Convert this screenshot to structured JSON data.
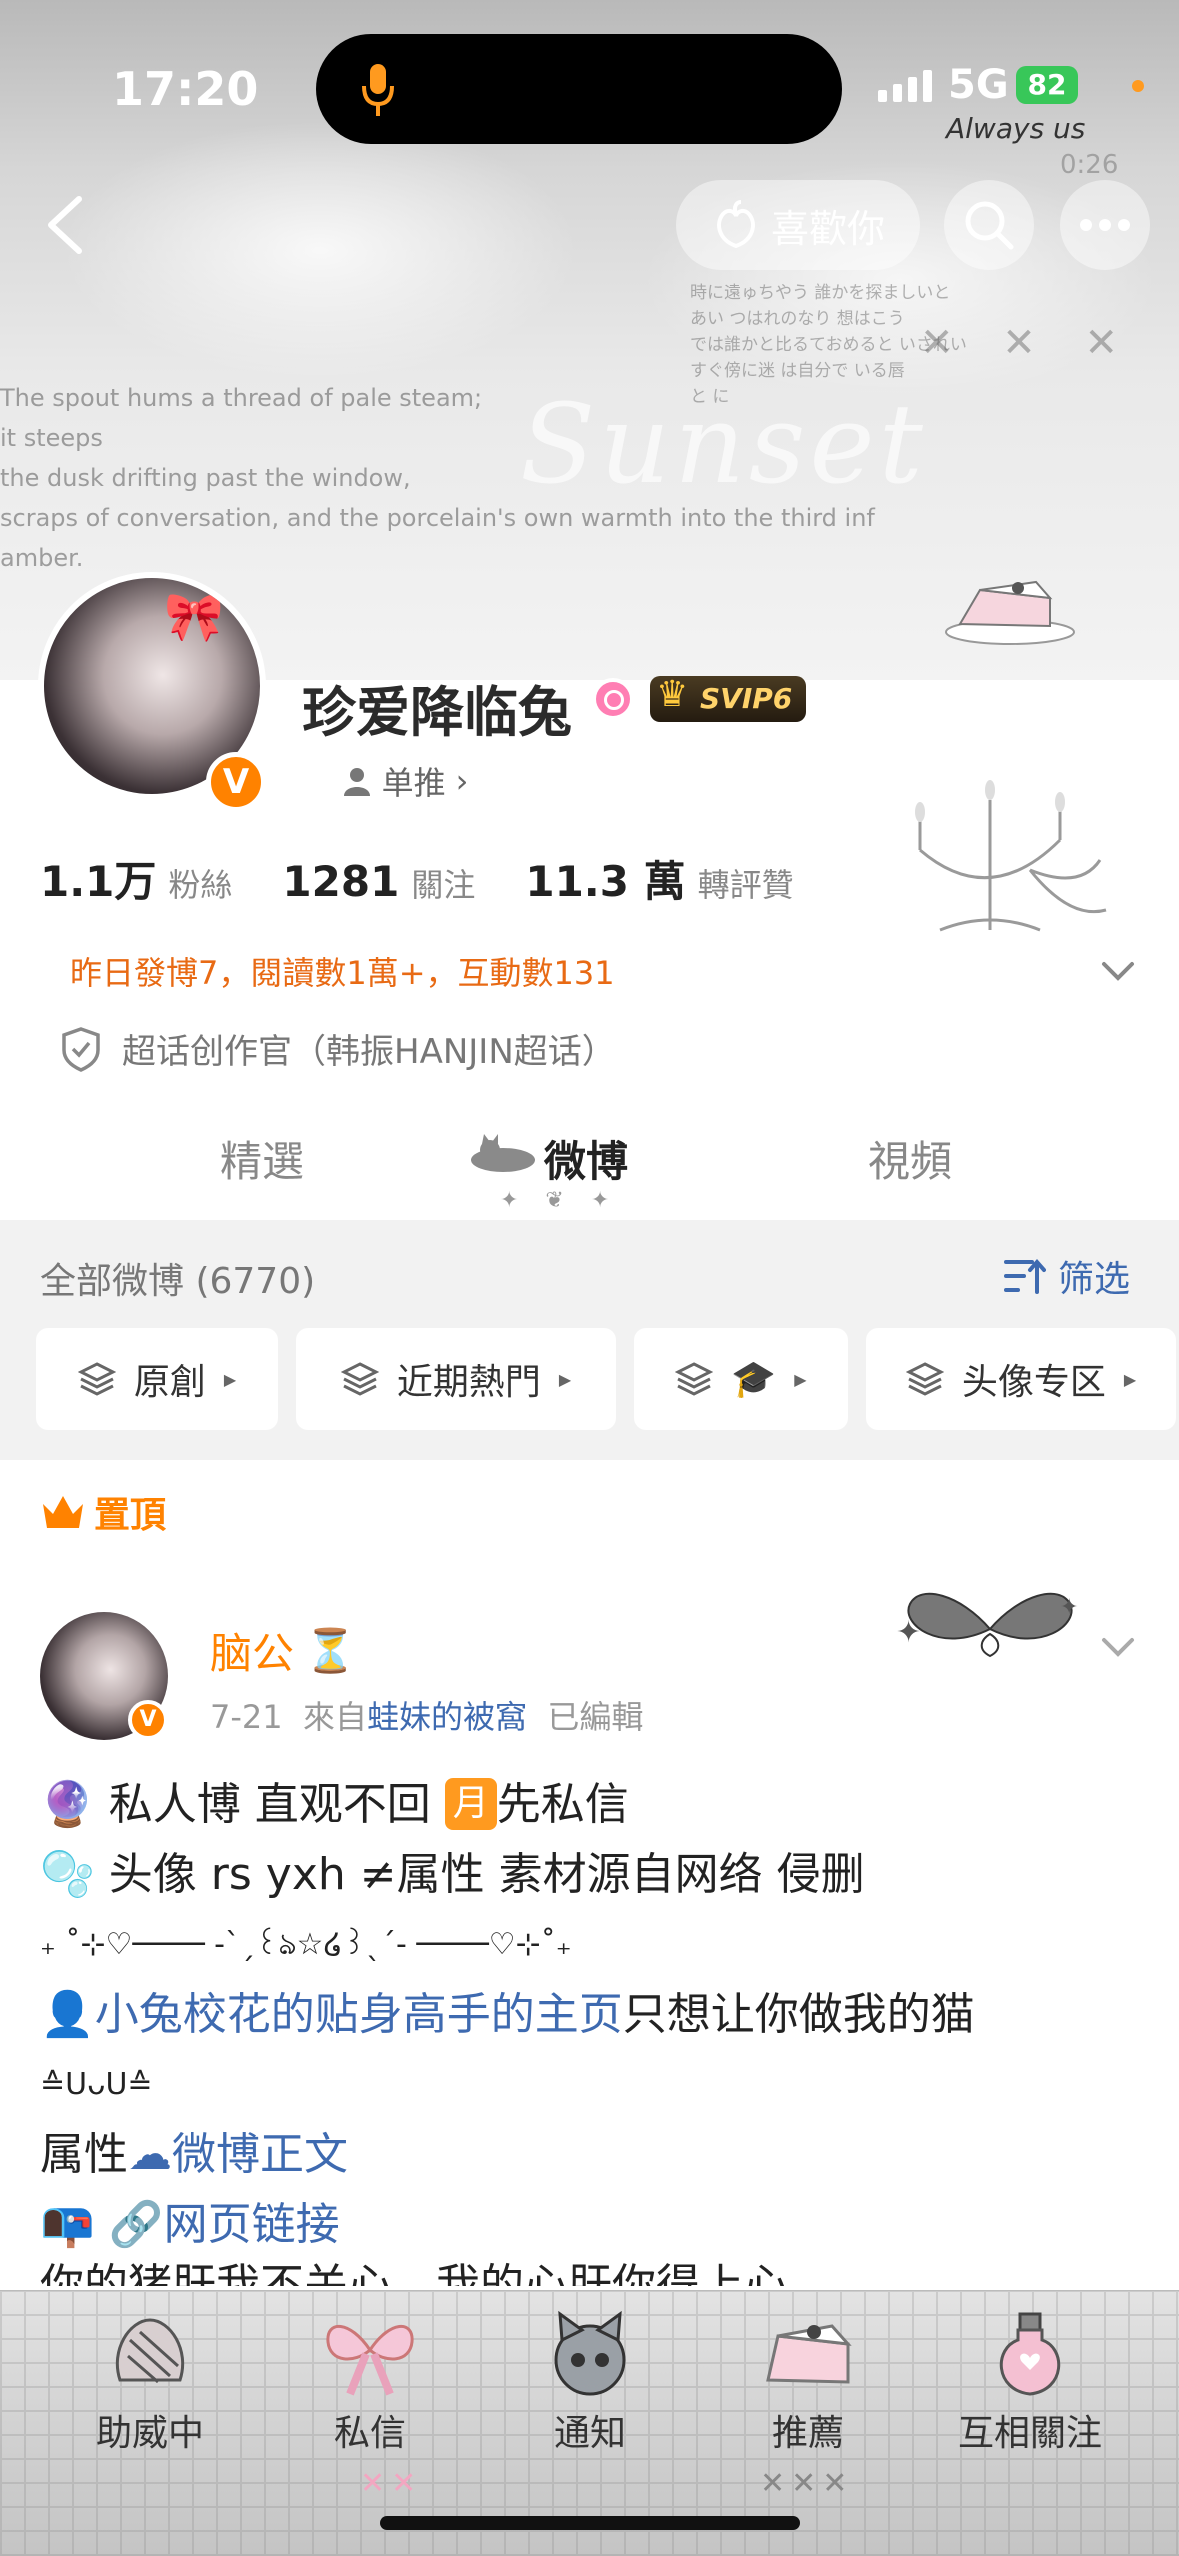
{
  "status_bar": {
    "time": "17:20",
    "network": "5G",
    "battery": "82",
    "carrier_note": "Always us"
  },
  "cover": {
    "poem": [
      "The spout hums a thread of pale steam;",
      "it steeps",
      "the dusk drifting past the window,",
      "scraps of conversation, and the porcelain's own warmth into the third inf",
      "amber."
    ],
    "jp_lines": [
      "時に遠ゅちやう 誰かを探ましいと",
      "あい つはれのなり 想はこう",
      "では誰かと比るておめると いされい",
      "すぐ傍に迷 は自分で いる唇",
      "と に"
    ],
    "script": "Sunset",
    "time_mark": "0:26",
    "marks": "✕ ✕ ✕"
  },
  "header": {
    "like_label": "喜歡你",
    "icons": {
      "back": "back-arrow-icon",
      "like": "peach-icon",
      "search": "search-icon",
      "more": "more-icon"
    }
  },
  "profile": {
    "name": "珍爱降临兔",
    "verified": "V",
    "svip": "SVIP6",
    "tag_label": "单推",
    "stats": [
      {
        "num": "1.1万",
        "label": "粉絲"
      },
      {
        "num": "1281",
        "label": "關注"
      },
      {
        "num": "11.3 萬",
        "label": "轉評贊"
      }
    ],
    "activity": "昨日發博7，閱讀數1萬+，互動數131",
    "chaohua": "超话创作官（韩振HANJIN超话）"
  },
  "tabs": [
    {
      "label": "精選"
    },
    {
      "label": "微博",
      "active": true
    },
    {
      "label": "視頻"
    }
  ],
  "tab_ornament": "✦ ❦ ✦",
  "feed": {
    "count_label": "全部微博 (6770)",
    "filter_label": "筛选",
    "chips": [
      {
        "label": "原創"
      },
      {
        "label": "近期熱門"
      },
      {
        "label": "🎓"
      },
      {
        "label": "头像专区"
      }
    ]
  },
  "post": {
    "pinned_label": "置頂",
    "author": "脑公",
    "author_badge": "⏳",
    "date": "7-21",
    "from_label": "來自",
    "source": "蛙妹的被窩",
    "edited": "已編輯",
    "line1_pre": "私人博 直观不回",
    "line1_tag": "月",
    "line1_post": "先私信",
    "line2": "头像 rs yxh ≠属性 素材源自网络 侵删",
    "line3": "₊ ˚⊹♡──── -ˋˏ꒰ঌ☆໒꒱ˎˊ- ────♡⊹˚₊",
    "line4_link": "小兔校花的贴身高手的主页",
    "line4_post": "只想让你做我的猫",
    "line5": "≙ᑌᴗᑌ≙",
    "line6_pre": "属性",
    "line6_link": "微博正文",
    "line7_link": "网页链接",
    "line8": "你的猪肝我不关心，我的心肝你得上心"
  },
  "bottom_nav": [
    {
      "label": "助威中",
      "icon": "candle-icon"
    },
    {
      "label": "私信",
      "icon": "bow-icon"
    },
    {
      "label": "通知",
      "icon": "cat-icon"
    },
    {
      "label": "推薦",
      "icon": "cake-icon"
    },
    {
      "label": "互相關注",
      "icon": "potion-icon"
    }
  ],
  "colors": {
    "accent": "#ff8200",
    "link": "#3e6ab0",
    "activity": "#e86a14"
  }
}
